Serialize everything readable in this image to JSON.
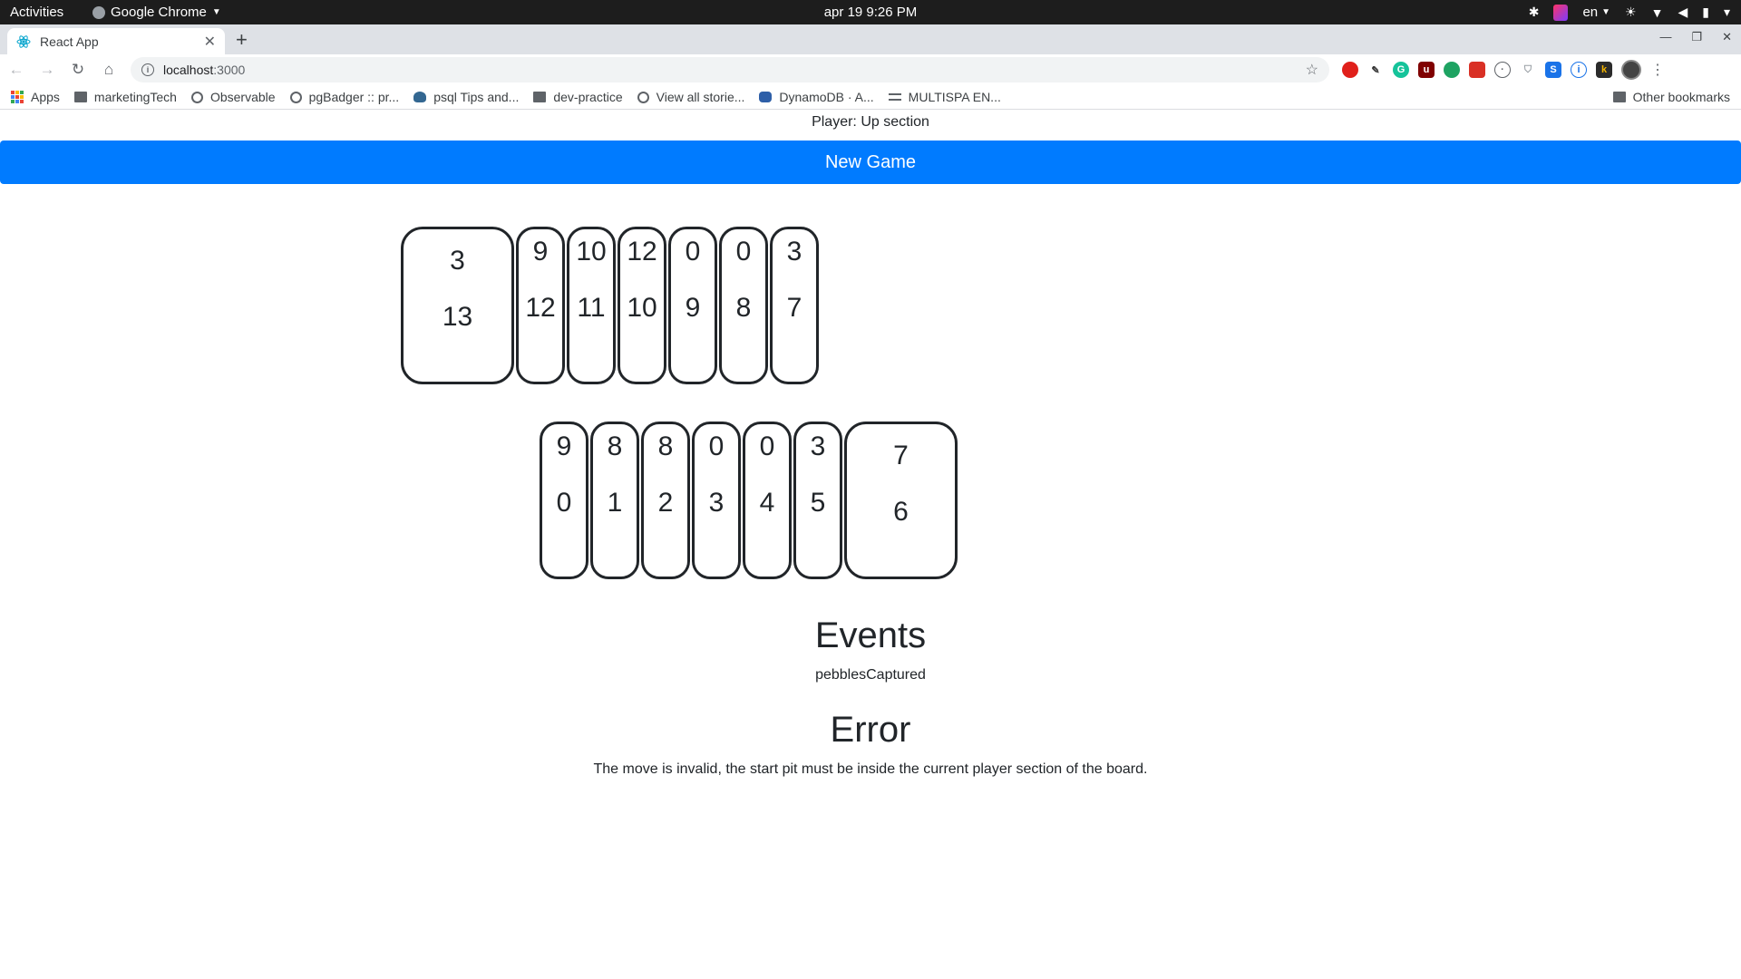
{
  "os": {
    "activities": "Activities",
    "app_name": "Google Chrome",
    "clock": "apr 19  9:26 PM",
    "lang": "en"
  },
  "browser": {
    "tab_title": "React App",
    "url_host": "localhost",
    "url_port": ":3000",
    "bookmarks": [
      {
        "label": "Apps",
        "icon": "apps-grid-icon"
      },
      {
        "label": "marketingTech",
        "icon": "folder-icon"
      },
      {
        "label": "Observable",
        "icon": "observable-icon"
      },
      {
        "label": "pgBadger :: pr...",
        "icon": "globe-icon"
      },
      {
        "label": "psql Tips and...",
        "icon": "elephant-icon"
      },
      {
        "label": "dev-practice",
        "icon": "folder-icon"
      },
      {
        "label": "View all storie...",
        "icon": "globe-icon"
      },
      {
        "label": "DynamoDB · A...",
        "icon": "database-icon"
      },
      {
        "label": "MULTISPA EN...",
        "icon": "lines-icon"
      }
    ],
    "other_bookmarks": "Other bookmarks",
    "colors": {
      "accent": "#007bff",
      "tabstrip": "#dee1e6"
    }
  },
  "game": {
    "player_text": "Player: Up section",
    "new_game_label": "New Game",
    "top_row": [
      {
        "seeds": "3",
        "index": "13",
        "kind": "store"
      },
      {
        "seeds": "9",
        "index": "12",
        "kind": "pit"
      },
      {
        "seeds": "10",
        "index": "11",
        "kind": "pit"
      },
      {
        "seeds": "12",
        "index": "10",
        "kind": "pit"
      },
      {
        "seeds": "0",
        "index": "9",
        "kind": "pit"
      },
      {
        "seeds": "0",
        "index": "8",
        "kind": "pit"
      },
      {
        "seeds": "3",
        "index": "7",
        "kind": "pit"
      }
    ],
    "bottom_row": [
      {
        "seeds": "9",
        "index": "0",
        "kind": "pit"
      },
      {
        "seeds": "8",
        "index": "1",
        "kind": "pit"
      },
      {
        "seeds": "8",
        "index": "2",
        "kind": "pit"
      },
      {
        "seeds": "0",
        "index": "3",
        "kind": "pit"
      },
      {
        "seeds": "0",
        "index": "4",
        "kind": "pit"
      },
      {
        "seeds": "3",
        "index": "5",
        "kind": "pit"
      },
      {
        "seeds": "7",
        "index": "6",
        "kind": "store"
      }
    ],
    "events_title": "Events",
    "events": [
      "pebblesCaptured"
    ],
    "error_title": "Error",
    "error_message": "The move is invalid, the start pit must be inside the current player section of the board."
  }
}
